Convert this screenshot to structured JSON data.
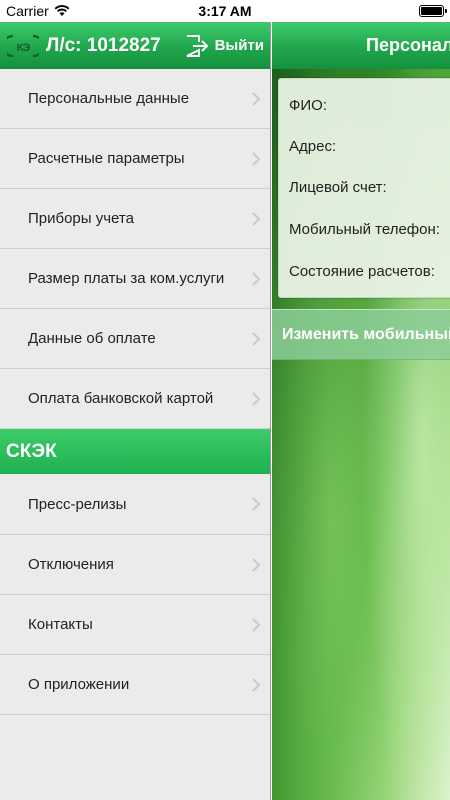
{
  "status_bar": {
    "carrier": "Carrier",
    "time": "3:17 AM"
  },
  "sidebar": {
    "header": {
      "logo": "СКЭК",
      "account": "Л/с: 1012827",
      "exit_label": "Выйти"
    },
    "items": [
      {
        "label": "Персональные данные"
      },
      {
        "label": "Расчетные параметры"
      },
      {
        "label": "Приборы учета"
      },
      {
        "label": "Размер платы за ком.услуги"
      },
      {
        "label": "Данные об оплате"
      },
      {
        "label": "Оплата банковской картой"
      }
    ],
    "section_title": "СКЭК",
    "section_items": [
      {
        "label": "Пресс-релизы"
      },
      {
        "label": "Отключения"
      },
      {
        "label": "Контакты"
      },
      {
        "label": "О приложении"
      }
    ]
  },
  "main": {
    "title": "Персональные данные",
    "fields": [
      {
        "label": "ФИО:"
      },
      {
        "label": "Адрес:"
      },
      {
        "label": "Лицевой счет:"
      },
      {
        "label": "Мобильный телефон:"
      },
      {
        "label": "Состояние расчетов:"
      }
    ],
    "change_button": "Изменить мобильный телефон"
  },
  "colors": {
    "accent_green": "#1ea34a",
    "sidebar_bg": "#ebebeb"
  }
}
